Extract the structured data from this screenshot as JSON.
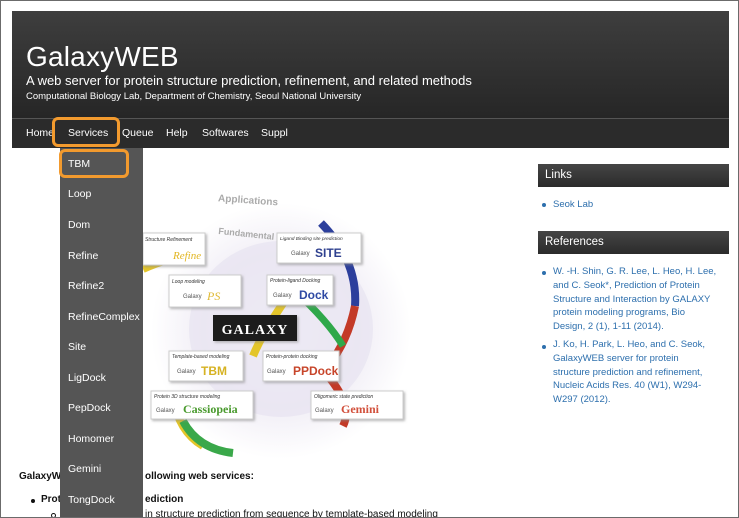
{
  "header": {
    "title": "GalaxyWEB",
    "subtitle": "A web server for protein structure prediction, refinement, and related methods",
    "affiliation": "Computational Biology Lab, Department of Chemistry, Seoul National University"
  },
  "nav": {
    "items": [
      "Home",
      "Services",
      "Queue",
      "Help",
      "Softwares",
      "Suppl"
    ],
    "highlighted": "Services"
  },
  "dropdown": {
    "items": [
      "TBM",
      "Loop",
      "Dom",
      "Refine",
      "Refine2",
      "RefineComplex",
      "Site",
      "LigDock",
      "PepDock",
      "Homomer",
      "Gemini",
      "TongDock"
    ],
    "highlighted": "TBM"
  },
  "figure": {
    "ring_outer": "Applications",
    "ring_inner": "Fundamental",
    "center": "GALAXY",
    "boxes": [
      {
        "caption": "Structure Refinement",
        "prefix": "",
        "name": "Refine",
        "color": "#e2b623"
      },
      {
        "caption": "Ligand Binding site prediction",
        "prefix": "Galaxy",
        "name": "SITE",
        "color": "#2e3f8f"
      },
      {
        "caption": "Loop modeling",
        "prefix": "Galaxy",
        "name": "PS",
        "color": "#e0ba34"
      },
      {
        "caption": "Protein-ligand Docking",
        "prefix": "Galaxy",
        "name": "Dock",
        "color": "#2f49a3"
      },
      {
        "caption": "Template-based modeling",
        "prefix": "Galaxy",
        "name": "TBM",
        "color": "#d6b222"
      },
      {
        "caption": "Protein-protein docking",
        "prefix": "Galaxy",
        "name": "PPDock",
        "color": "#c7442a"
      },
      {
        "caption": "Protein 3D structure modeling",
        "prefix": "Galaxy",
        "name": "Cassiopeia",
        "color": "#4a9a2e"
      },
      {
        "caption": "Oligomeric state prediction",
        "prefix": "Galaxy",
        "name": "Gemini",
        "color": "#d2513c"
      }
    ]
  },
  "sidebar": {
    "links_title": "Links",
    "links": [
      "Seok Lab"
    ],
    "refs_title": "References",
    "refs": [
      [
        "W. -H. Shin, G. R. Lee, L. Heo, H. Lee,",
        "and C. Seok*, Prediction of Protein",
        "Structure and Interaction by GALAXY",
        "protein modeling programs, Bio",
        "Design, 2 (1), 1-11 (2014)."
      ],
      [
        "J. Ko, H. Park, L. Heo, and C. Seok,",
        "GalaxyWEB server for protein",
        "structure prediction and refinement,",
        "Nucleic Acids Res. 40 (W1), W294-",
        "W297 (2012)."
      ]
    ]
  },
  "main_text": {
    "intro_left": "GalaxyW",
    "intro_right": "ollowing web services:",
    "item1_left": "Prot",
    "item1_right": "ediction",
    "sub1": "in structure prediction from sequence by template-based modeling"
  },
  "colors": {
    "highlight": "#f29a2e",
    "link": "#2d6fad",
    "header_bg": "#2b2b2b",
    "dropdown_bg": "#555555"
  }
}
